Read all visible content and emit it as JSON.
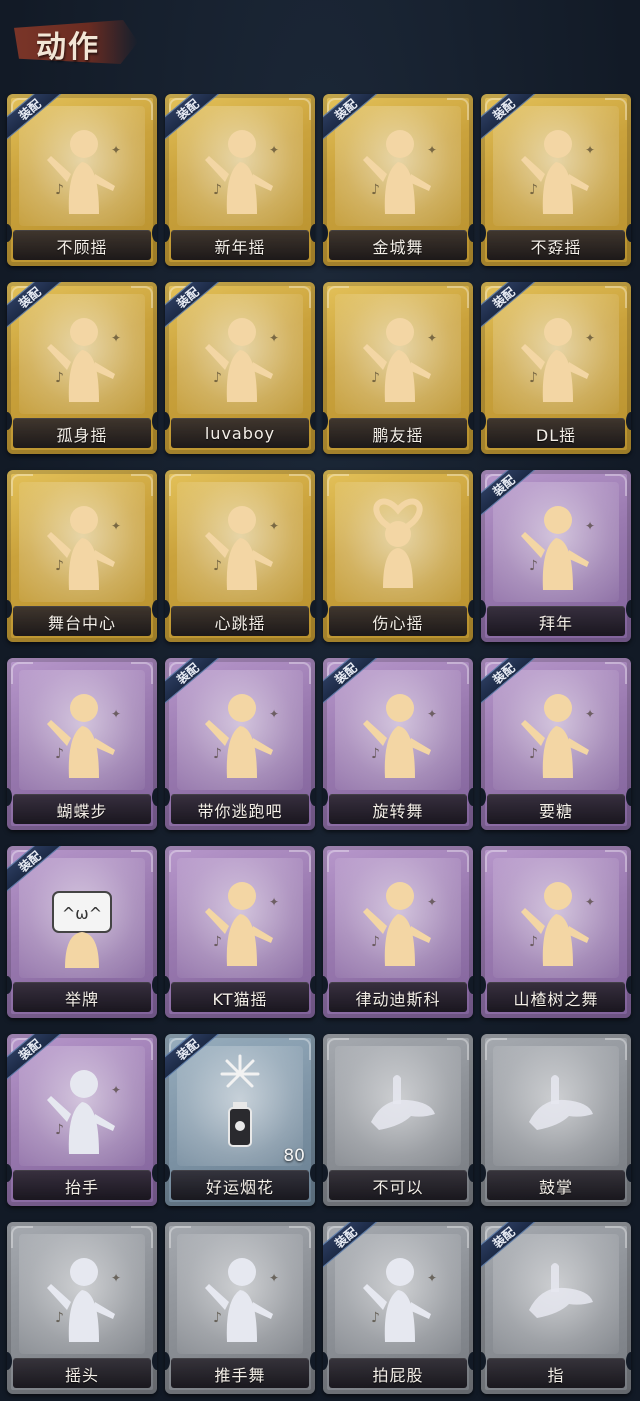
{
  "header": {
    "title": "动作"
  },
  "badge_label": "装配",
  "colors": {
    "gold": "#caa23c",
    "purple": "#9a7ab0",
    "blue": "#7e94a6",
    "gray": "#8c9096",
    "figure_gold": "#f3d6a4",
    "figure_silver": "#e6e8f0"
  },
  "cards": [
    {
      "label": "不顾摇",
      "tier": "gold",
      "equipped": true,
      "icon": "dance-pose-icon"
    },
    {
      "label": "新年摇",
      "tier": "gold",
      "equipped": true,
      "icon": "dance-pose-icon"
    },
    {
      "label": "金城舞",
      "tier": "gold",
      "equipped": true,
      "icon": "dance-pose-icon"
    },
    {
      "label": "不孬摇",
      "tier": "gold",
      "equipped": true,
      "icon": "dance-pose-icon"
    },
    {
      "label": "孤身摇",
      "tier": "gold",
      "equipped": true,
      "icon": "dance-pose-icon"
    },
    {
      "label": "luvaboy",
      "tier": "gold",
      "equipped": true,
      "icon": "dance-pose-icon"
    },
    {
      "label": "鹏友摇",
      "tier": "gold",
      "equipped": false,
      "icon": "dance-pose-icon"
    },
    {
      "label": "DL摇",
      "tier": "gold",
      "equipped": true,
      "icon": "dance-pose-icon"
    },
    {
      "label": "舞台中心",
      "tier": "gold",
      "equipped": false,
      "icon": "dance-pose-icon"
    },
    {
      "label": "心跳摇",
      "tier": "gold",
      "equipped": false,
      "icon": "dance-pose-icon"
    },
    {
      "label": "伤心摇",
      "tier": "gold",
      "equipped": false,
      "icon": "heart-pose-icon"
    },
    {
      "label": "拜年",
      "tier": "purple",
      "equipped": true,
      "icon": "bow-pose-icon"
    },
    {
      "label": "蝴蝶步",
      "tier": "purple",
      "equipped": false,
      "icon": "dance-pose-icon"
    },
    {
      "label": "带你逃跑吧",
      "tier": "purple",
      "equipped": true,
      "icon": "dance-pose-icon"
    },
    {
      "label": "旋转舞",
      "tier": "purple",
      "equipped": true,
      "icon": "spin-pose-icon"
    },
    {
      "label": "要糖",
      "tier": "purple",
      "equipped": true,
      "icon": "bow-pose-icon"
    },
    {
      "label": "举牌",
      "tier": "purple",
      "equipped": true,
      "icon": "sign-pose-icon"
    },
    {
      "label": "KT猫摇",
      "tier": "purple",
      "equipped": false,
      "icon": "dance-pose-icon"
    },
    {
      "label": "律动迪斯科",
      "tier": "purple",
      "equipped": false,
      "icon": "dance-pose-icon"
    },
    {
      "label": "山楂树之舞",
      "tier": "purple",
      "equipped": false,
      "icon": "dance-pose-icon"
    },
    {
      "label": "抬手",
      "tier": "purple",
      "equipped": true,
      "icon": "bow-pose-icon"
    },
    {
      "label": "好运烟花",
      "tier": "blue",
      "equipped": true,
      "icon": "firework-icon",
      "count": "80"
    },
    {
      "label": "不可以",
      "tier": "gray",
      "equipped": false,
      "icon": "finger-wag-icon"
    },
    {
      "label": "鼓掌",
      "tier": "gray",
      "equipped": false,
      "icon": "clap-icon"
    },
    {
      "label": "摇头",
      "tier": "gray",
      "equipped": false,
      "icon": "bow-pose-icon"
    },
    {
      "label": "推手舞",
      "tier": "gray",
      "equipped": false,
      "icon": "bow-pose-icon"
    },
    {
      "label": "拍屁股",
      "tier": "gray",
      "equipped": true,
      "icon": "bow-pose-icon"
    },
    {
      "label": "指",
      "tier": "gray",
      "equipped": true,
      "icon": "point-hand-icon"
    }
  ]
}
